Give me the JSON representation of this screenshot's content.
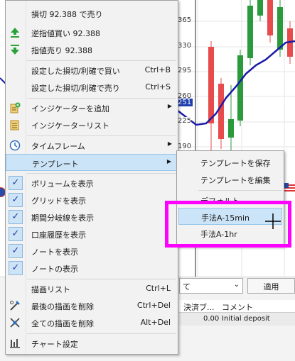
{
  "chart": {
    "price_labels": [
      "365",
      "330",
      "295",
      "260",
      "251",
      "225",
      "190"
    ],
    "highlight_price": "251",
    "colors": {
      "bull": "#2b9a3c",
      "bear": "#e74b4b",
      "ma": "#1a1aa8",
      "highlight": "#1f3fae"
    }
  },
  "bottom_panel": {
    "period_select": "て",
    "apply_button": "適用",
    "columns": [
      "決済ブ...",
      "コメント"
    ],
    "row": {
      "amount": "0.00",
      "comment": "Initial deposit"
    }
  },
  "menu": {
    "stop_sell": "損切 92.388 で売り",
    "stop_buy": "逆指値買い 92.388",
    "limit_sell": "指値売り 92.388",
    "buy_sl_tp": "設定した損切/利確で買い",
    "buy_sl_tp_shortcut": "Ctrl+B",
    "sell_sl_tp": "設定した損切/利確で売り",
    "sell_sl_tp_shortcut": "Ctrl+S",
    "add_indicator": "インジケーターを追加",
    "indicator_list": "インジケーターリスト",
    "timeframe": "タイムフレーム",
    "template": "テンプレート",
    "show_volume": "ボリュームを表示",
    "show_grid": "グリッドを表示",
    "show_period_sep": "期間分岐線を表示",
    "show_history": "口座履歴を表示",
    "show_notes": "ノートを表示",
    "show_notes2": "ノートの表示",
    "drawing_list": "描画リスト",
    "drawing_list_shortcut": "Ctrl+L",
    "delete_last": "最後の描画を削除",
    "delete_last_shortcut": "Ctrl+Del",
    "delete_all": "全ての描画を削除",
    "delete_all_shortcut": "Alt+Del",
    "chart_settings": "チャート設定"
  },
  "submenu": {
    "save_template": "テンプレートを保存",
    "edit_template": "テンプレートを編集",
    "default": "デフォルト",
    "method_15": "手法A-15min",
    "method_1h": "手法A-1hr"
  }
}
